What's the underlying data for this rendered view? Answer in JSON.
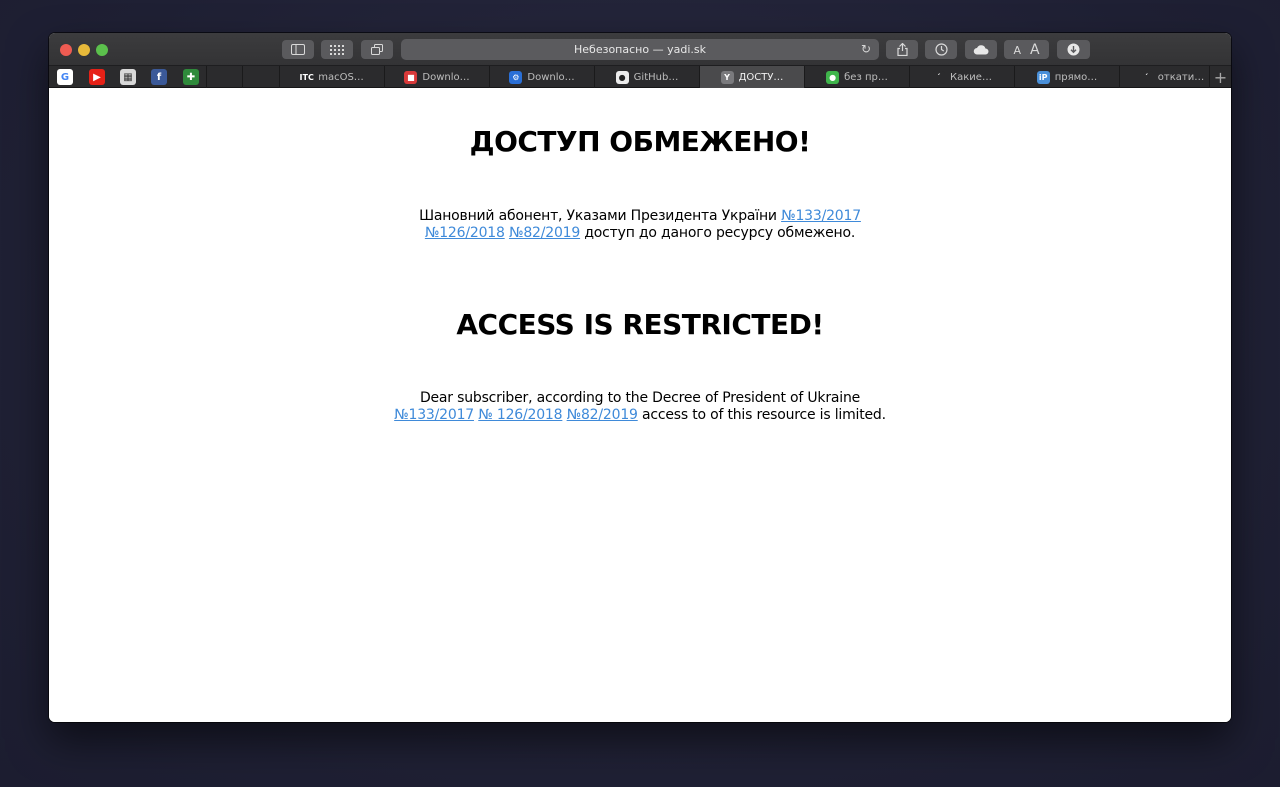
{
  "browser": {
    "address_text": "Небезопасно — yadi.sk",
    "toolbar_icons": [
      "sidebar-icon",
      "grid-icon",
      "tabs-overview-icon",
      "share-icon",
      "history-icon",
      "cloud-icon",
      "font-size-icon",
      "download-icon"
    ],
    "font_small": "A",
    "font_large": "A",
    "favorites": [
      {
        "name": "google",
        "glyph": "G",
        "color": "#ffffff",
        "fg": "#4285f4"
      },
      {
        "name": "youtube",
        "glyph": "▶",
        "color": "#e62117",
        "fg": "#ffffff"
      },
      {
        "name": "mail",
        "glyph": "▦",
        "color": "#d8d8d8",
        "fg": "#333333"
      },
      {
        "name": "facebook",
        "glyph": "f",
        "color": "#3b5998",
        "fg": "#ffffff"
      },
      {
        "name": "plus-extension",
        "glyph": "✚",
        "color": "#2f8a3b",
        "fg": "#ffffff"
      }
    ],
    "tabs": [
      {
        "label": "macOS…",
        "icon": "ITC",
        "icon_color": "#2b2b2d",
        "active": false
      },
      {
        "label": "Downlo…",
        "icon": "■",
        "icon_color": "#d93a3a",
        "active": false
      },
      {
        "label": "Downlo…",
        "icon": "⚙",
        "icon_color": "#2a6fd6",
        "active": false
      },
      {
        "label": "GitHub…",
        "icon": "●",
        "icon_color": "#ececec",
        "active": false
      },
      {
        "label": "ДОСТУ…",
        "icon": "Y",
        "icon_color": "#7a7a7d",
        "active": true
      },
      {
        "label": "без пр…",
        "icon": "●",
        "icon_color": "#3fb54b",
        "active": false
      },
      {
        "label": "Какие…",
        "icon": "ˊ",
        "icon_color": "#2b2b2d",
        "active": false
      },
      {
        "label": "прямо…",
        "icon": "iP",
        "icon_color": "#4a90d9",
        "active": false
      },
      {
        "label": "откати…",
        "icon": "ˊ",
        "icon_color": "#2b2b2d",
        "active": false
      }
    ],
    "new_tab_label": "+"
  },
  "page": {
    "ua": {
      "heading": "ДОСТУП ОБМЕЖЕНО!",
      "text_before": "Шановний абонент, Указами Президента України ",
      "links": [
        "№133/2017",
        "№126/2018",
        "№82/2019"
      ],
      "text_after": " доступ до даного ресурсу обмежено."
    },
    "en": {
      "heading": "ACCESS IS RESTRICTED!",
      "text_before": "Dear subscriber, according to the Decree of President of Ukraine ",
      "links": [
        "№133/2017",
        "№ 126/2018",
        "№82/2019"
      ],
      "text_after": " access to of this resource is limited."
    }
  },
  "colors": {
    "link": "#3f8ad9",
    "chrome_dark": "#333335",
    "active_tab": "#4a4a4c"
  }
}
